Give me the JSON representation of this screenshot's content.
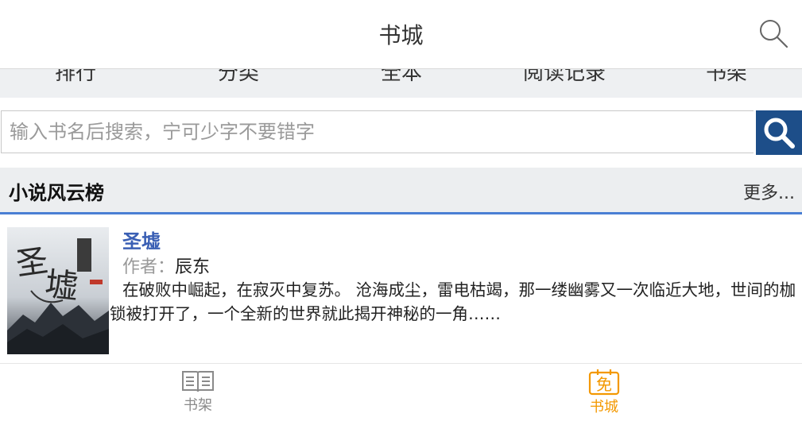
{
  "header": {
    "title": "书城"
  },
  "nav": {
    "items": [
      "排行",
      "分类",
      "全本",
      "阅读记录",
      "书架"
    ]
  },
  "search": {
    "placeholder": "输入书名后搜索，宁可少字不要错字"
  },
  "section": {
    "title": "小说风云榜",
    "more": "更多..."
  },
  "book": {
    "title": "圣墟",
    "author_label": "作者：",
    "author": "辰东",
    "description": "在破败中崛起，在寂灭中复苏。 沧海成尘，雷电枯竭，那一缕幽雾又一次临近大地，世间的枷锁被打开了，一个全新的世界就此揭开神秘的一角……",
    "cover_text": "圣墟"
  },
  "tabbar": {
    "shelf_label": "书架",
    "store_label": "书城",
    "store_icon_char": "免"
  },
  "colors": {
    "accent_blue": "#1d4e89",
    "link_blue": "#3a5fb4",
    "active_orange": "#f39800",
    "section_border": "#4a7fd4"
  }
}
